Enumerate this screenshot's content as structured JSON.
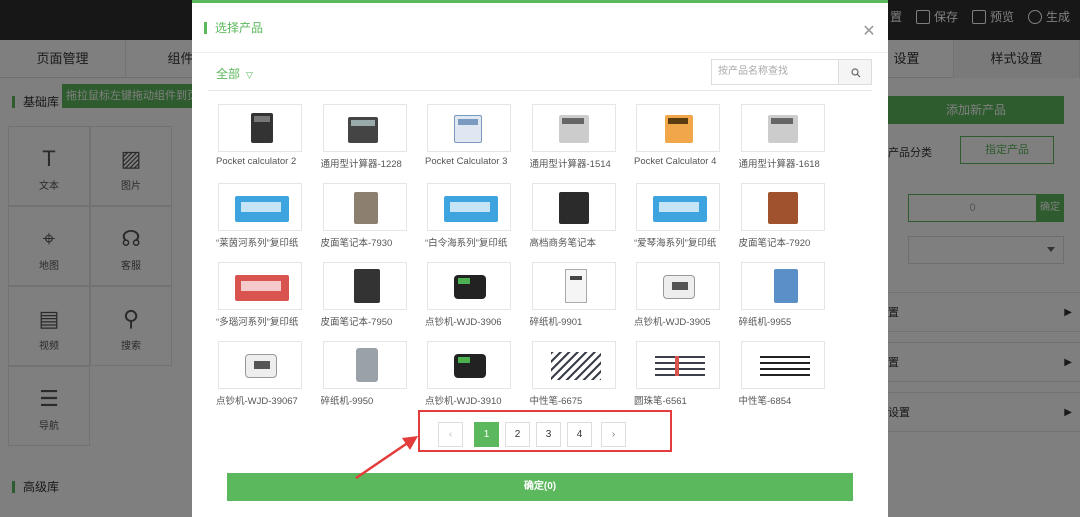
{
  "topbar": {
    "tools": [
      {
        "label": "置",
        "icon": "settings-icon"
      },
      {
        "label": "保存",
        "icon": "save-icon"
      },
      {
        "label": "预览",
        "icon": "preview-icon"
      },
      {
        "label": "生成",
        "icon": "generate-icon"
      }
    ]
  },
  "editor": {
    "tabs": [
      "页面管理",
      "组件",
      "设置",
      "样式设置"
    ],
    "left": {
      "basic_title": "基础库",
      "hint": "拖拉鼠标左键拖动组件到页面",
      "components": [
        {
          "label": "文本",
          "icon": "text-icon"
        },
        {
          "label": "图片",
          "icon": "image-icon"
        },
        {
          "label": "地图",
          "icon": "map-pin-icon"
        },
        {
          "label": "客服",
          "icon": "headset-icon"
        },
        {
          "label": "视频",
          "icon": "video-icon"
        },
        {
          "label": "搜索",
          "icon": "search-icon"
        },
        {
          "label": "导航",
          "icon": "list-icon"
        }
      ],
      "advanced_title": "高级库"
    },
    "right": {
      "add_product": "添加新产品",
      "category_label": "产品分类",
      "specify_product": "指定产品",
      "slider_value": "0",
      "slider_btn": "确定",
      "rows": [
        "置",
        "置",
        "设置"
      ]
    }
  },
  "modal": {
    "title": "选择产品",
    "category": "全部",
    "search_placeholder": "按产品名称查找",
    "products": [
      {
        "name": "Pocket calculator 2",
        "thumb": "calc-black"
      },
      {
        "name": "通用型计算器-1228",
        "thumb": "calc-desk"
      },
      {
        "name": "Pocket Calculator 3",
        "thumb": "calc-blue"
      },
      {
        "name": "通用型计算器-1514",
        "thumb": "calc-grey"
      },
      {
        "name": "Pocket Calculator 4",
        "thumb": "calc-orange"
      },
      {
        "name": "通用型计算器-1618",
        "thumb": "calc-grey"
      },
      {
        "name": "“莱茵河系列”复印纸",
        "thumb": "paper"
      },
      {
        "name": "皮面笔记本-7930",
        "thumb": "nb-grey"
      },
      {
        "name": "“白令海系列”复印纸",
        "thumb": "paper"
      },
      {
        "name": "高档商务笔记本",
        "thumb": "nb-black"
      },
      {
        "name": "“爱琴海系列”复印纸",
        "thumb": "paper"
      },
      {
        "name": "皮面笔记本-7920",
        "thumb": "nb-brown"
      },
      {
        "name": "“多瑙河系列”复印纸",
        "thumb": "paper-red"
      },
      {
        "name": "皮面笔记本-7950",
        "thumb": "nb-black2"
      },
      {
        "name": "点钞机-WJD-3906",
        "thumb": "counter"
      },
      {
        "name": "碎纸机-9901",
        "thumb": "shred-w"
      },
      {
        "name": "点钞机-WJD-3905",
        "thumb": "counter-w"
      },
      {
        "name": "碎纸机-9955",
        "thumb": "shred-b"
      },
      {
        "name": "点钞机-WJD-39067",
        "thumb": "counter-w"
      },
      {
        "name": "碎纸机-9950",
        "thumb": "shred-s"
      },
      {
        "name": "点钞机-WJD-3910",
        "thumb": "counter"
      },
      {
        "name": "中性笔-6675",
        "thumb": "pens"
      },
      {
        "name": "圆珠笔-6561",
        "thumb": "pens-red"
      },
      {
        "name": "中性笔-6854",
        "thumb": "pens-blk"
      }
    ],
    "pagination": {
      "prev": "‹",
      "pages": [
        "1",
        "2",
        "3",
        "4"
      ],
      "current": "1",
      "next": "›"
    },
    "confirm": "确定(0)"
  },
  "colors": {
    "accent": "#5cb85c",
    "annotation": "#e23c3c"
  }
}
